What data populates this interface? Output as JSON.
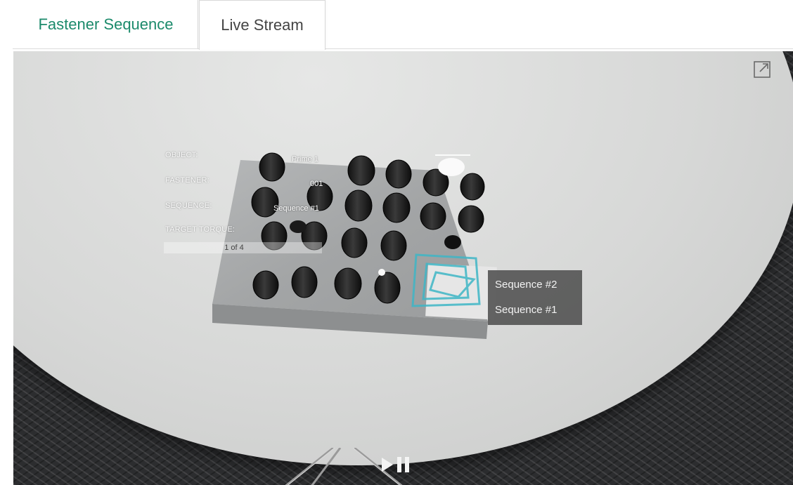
{
  "tabs": [
    {
      "label": "Fastener Sequence",
      "active": false
    },
    {
      "label": "Live Stream",
      "active": true
    }
  ],
  "overlay": {
    "labels": {
      "object": "OBJECT:",
      "fastener": "FASTENER:",
      "sequence": "SEQUENCE:",
      "target_torque": "TARGET TORQUE:"
    },
    "values": {
      "object": "Prime 1",
      "fastener": "001",
      "sequence": "Sequence #1"
    },
    "progress": "1 of 4"
  },
  "sequence_menu": {
    "items": [
      "Sequence #2",
      "Sequence #1"
    ]
  },
  "controls": {
    "expand_icon": "expand-icon",
    "play_icon": "play-icon",
    "pause_icon": "pause-icon"
  },
  "colors": {
    "active_tab_text": "#1b8a6b",
    "tab_text": "#444444",
    "marker_teal": "#3fb6c6"
  }
}
